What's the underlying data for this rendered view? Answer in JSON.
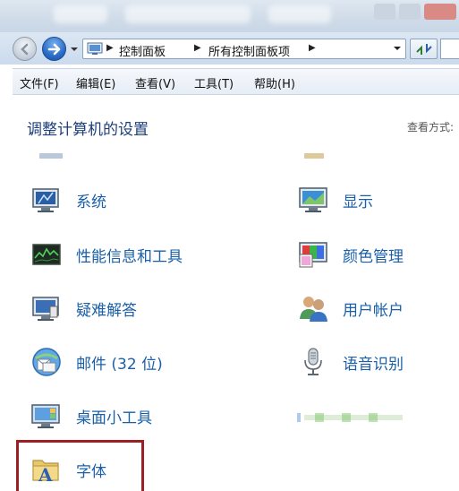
{
  "nav": {
    "breadcrumbs": [
      "控制面板",
      "所有控制面板项"
    ]
  },
  "menu": [
    "文件(F)",
    "编辑(E)",
    "查看(V)",
    "工具(T)",
    "帮助(H)"
  ],
  "content": {
    "title": "调整计算机的设置",
    "view_mode_label": "查看方式:"
  },
  "items_left": [
    {
      "label": "系统",
      "icon": "system-icon"
    },
    {
      "label": "性能信息和工具",
      "icon": "performance-icon"
    },
    {
      "label": "疑难解答",
      "icon": "troubleshoot-icon"
    },
    {
      "label": "邮件 (32 位)",
      "icon": "mail-icon"
    },
    {
      "label": "桌面小工具",
      "icon": "gadgets-icon"
    },
    {
      "label": "字体",
      "icon": "fonts-icon"
    }
  ],
  "items_right": [
    {
      "label": "显示",
      "icon": "display-icon"
    },
    {
      "label": "颜色管理",
      "icon": "color-management-icon"
    },
    {
      "label": "用户帐户",
      "icon": "user-accounts-icon"
    },
    {
      "label": "语音识别",
      "icon": "speech-recognition-icon"
    }
  ],
  "colors": {
    "link": "#1a5fa8",
    "title": "#1e3f7a",
    "highlight": "#9b1f24"
  }
}
